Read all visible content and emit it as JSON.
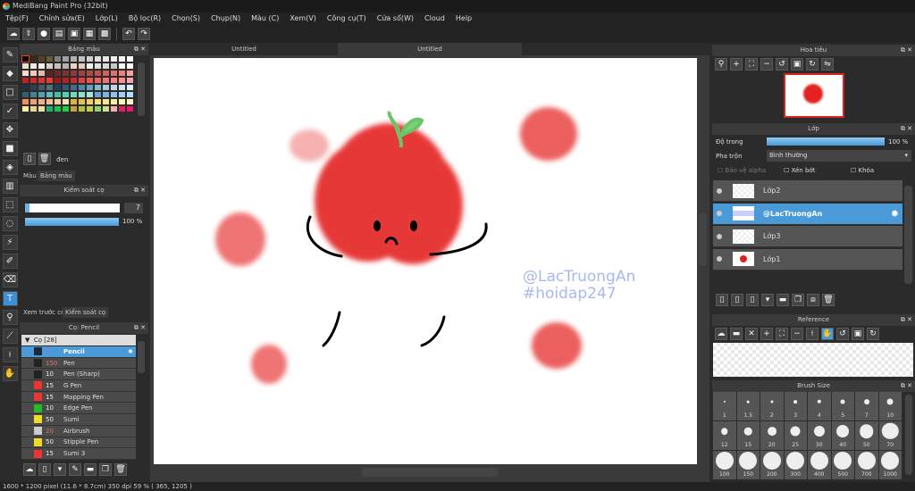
{
  "window": {
    "title": "MediBang Paint Pro (32bit)"
  },
  "menu": [
    "Tệp(F)",
    "Chỉnh sửa(E)",
    "Lớp(L)",
    "Bộ lọc(R)",
    "Chọn(S)",
    "Chụp(N)",
    "Màu (C)",
    "Xem(V)",
    "Công cụ(T)",
    "Cửa sổ(W)",
    "Cloud",
    "Help"
  ],
  "doc_tabs": [
    "Untitled",
    "Untitled"
  ],
  "palette_panel": {
    "title": "Bảng màu",
    "color_name": "đen",
    "tabs": [
      "Màu",
      "Bảng màu"
    ],
    "colors": [
      "#000000",
      "#3a2a1a",
      "#5a4020",
      "#6a5a3a",
      "#808080",
      "#a0a0a0",
      "#b0b0b0",
      "#c0c0c0",
      "#d0d0d0",
      "#e0e0e0",
      "#e8e8e8",
      "#f0f0f0",
      "#f8f8f8",
      "#ffffff",
      "#e8e0d0",
      "#f0e8e0",
      "#f8f0e8",
      "#d8d0c8",
      "#c8c0b8",
      "#b8b0a8",
      "#f0d0c0",
      "#e8c8b8",
      "#f0f0f0",
      "#e0e0e0",
      "#d8d8d8",
      "#c8c8c8",
      "#f8f8f8",
      "#ffffff",
      "#f8d8d0",
      "#f0c8c0",
      "#e8b8b0",
      "#602020",
      "#702828",
      "#803030",
      "#903838",
      "#a04040",
      "#b04848",
      "#c05050",
      "#d06060",
      "#e07070",
      "#f08080",
      "#f8a0a0",
      "#c02020",
      "#d02828",
      "#e03030",
      "#f03838",
      "#a01818",
      "#b82020",
      "#c82828",
      "#e04040",
      "#f05050",
      "#f06060",
      "#f87070",
      "#f88080",
      "#f89090",
      "#f8a8a8",
      "#203040",
      "#304050",
      "#405868",
      "#507080",
      "#204060",
      "#305878",
      "#407090",
      "#5088a8",
      "#60a0c0",
      "#80b8d0",
      "#a0c8e0",
      "#c0d8e8",
      "#d0e0f0",
      "#e0f0f8",
      "#306070",
      "#408090",
      "#50a0b0",
      "#60b8c0",
      "#40c0a0",
      "#50d0b0",
      "#70d8c0",
      "#90e0d0",
      "#a0e8d8",
      "#70a0d0",
      "#80b0e0",
      "#90c0f0",
      "#a0d0f8",
      "#b0e0ff",
      "#f09060",
      "#f0a070",
      "#f0b080",
      "#f8c090",
      "#f8d0a0",
      "#f8e0b0",
      "#e0b040",
      "#e8c050",
      "#f0d060",
      "#f8e070",
      "#f8e890",
      "#f8f0a0",
      "#f8f8b0",
      "#fff8c0",
      "#f8f0a0",
      "#f0d090",
      "#e8e0a0",
      "#20b070",
      "#20c050",
      "#20d040",
      "#c8a040",
      "#b0c040",
      "#c0d040",
      "#90d070",
      "#d0e090",
      "#f0b0b0",
      "#e02060",
      "#e81870"
    ]
  },
  "brush_control": {
    "title": "Kiểm soát cọ",
    "size": "7",
    "opacity": "100 %",
    "size_fraction": 0.05,
    "opacity_fraction": 1.0,
    "tabs": [
      "Xem trước cọ",
      "Kiểm soát cọ"
    ]
  },
  "brush_panel": {
    "title": "Cọ: Pencil",
    "group": "Cọ [28]",
    "items": [
      {
        "color": "#1a2a3a",
        "size": "7",
        "name": "Pencil",
        "size_color": "#b070e0",
        "selected": true
      },
      {
        "color": "#222222",
        "size": "150",
        "name": "Pen",
        "size_color": "#e07070"
      },
      {
        "color": "#222222",
        "size": "10",
        "name": "Pen (Sharp)"
      },
      {
        "color": "#ee3333",
        "size": "15",
        "name": "G Pen"
      },
      {
        "color": "#ee3333",
        "size": "15",
        "name": "Mapping Pen"
      },
      {
        "color": "#22bb22",
        "size": "10",
        "name": "Edge Pen"
      },
      {
        "color": "#eedd22",
        "size": "50",
        "name": "Sumi"
      },
      {
        "color": "#cccccc",
        "size": "20",
        "name": "Airbrush",
        "size_color": "#e07070"
      },
      {
        "color": "#eedd22",
        "size": "50",
        "name": "Stipple Pen"
      },
      {
        "color": "#ee3333",
        "size": "15",
        "name": "Sumi 3"
      }
    ]
  },
  "canvas": {
    "watermark_line1": "@LacTruongAn",
    "watermark_line2": "#hoidap247",
    "watermark_color": "#a8b8f0",
    "fruit_color": "#e52222"
  },
  "navigator": {
    "title": "Hoa tiêu"
  },
  "layers": {
    "title": "Lớp",
    "opacity_label": "Độ trong",
    "opacity": "100 %",
    "opacity_fraction": 1.0,
    "blend_label": "Pha trộn",
    "blend_value": "Bình thường",
    "protect_alpha": "Bảo vệ alpha",
    "clipping": "Xén bớt",
    "lock": "Khóa",
    "items": [
      {
        "name": "Lớp2"
      },
      {
        "name": "@LacTruongAn",
        "selected": true
      },
      {
        "name": "Lớp3"
      },
      {
        "name": "Lớp1"
      }
    ]
  },
  "reference": {
    "title": "Reference"
  },
  "brush_size": {
    "title": "Brush Size",
    "sizes": [
      "1",
      "1.5",
      "2",
      "3",
      "4",
      "5",
      "7",
      "10",
      "12",
      "15",
      "20",
      "25",
      "30",
      "40",
      "50",
      "70",
      "100",
      "150",
      "200",
      "300",
      "400",
      "500",
      "700",
      "1000"
    ]
  },
  "status": "1600 * 1200 pixel   (11.6 * 8.7cm)   350 dpi   59 %   ( 365, 1205 )"
}
